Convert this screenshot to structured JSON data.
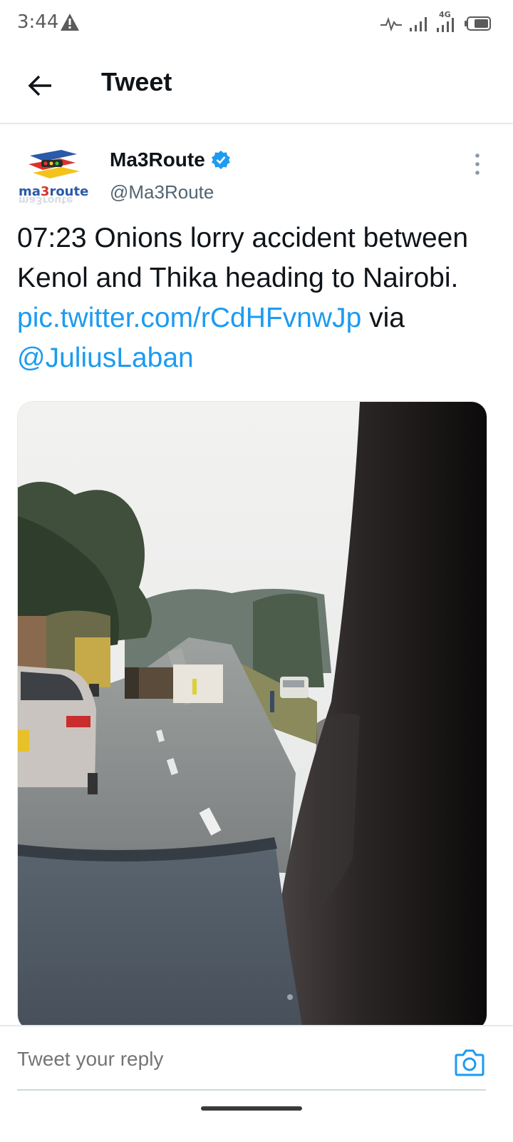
{
  "status_bar": {
    "time": "3:44",
    "network_label": "4G",
    "icons": [
      "warning-icon",
      "activity-icon",
      "signal-icon",
      "signal-4g-icon",
      "battery-icon"
    ]
  },
  "header": {
    "title": "Tweet",
    "back_icon": "arrow-left-icon"
  },
  "tweet": {
    "avatar_text": "ma3route",
    "display_name": "Ma3Route",
    "verified": true,
    "handle": "@Ma3Route",
    "text_main": "07:23 Onions lorry accident between Kenol and Thika heading to Nairobi.",
    "link_url": "pic.twitter.com/​rCdHFvnwJp",
    "text_via": "via",
    "mention": "@JuliusLaban",
    "media_alt_icon": "photo-road-accident",
    "colors": {
      "link": "#1d9bf0",
      "verified": "#1d9bf0"
    }
  },
  "reply": {
    "placeholder": "Tweet your reply",
    "camera_icon": "camera-icon"
  }
}
